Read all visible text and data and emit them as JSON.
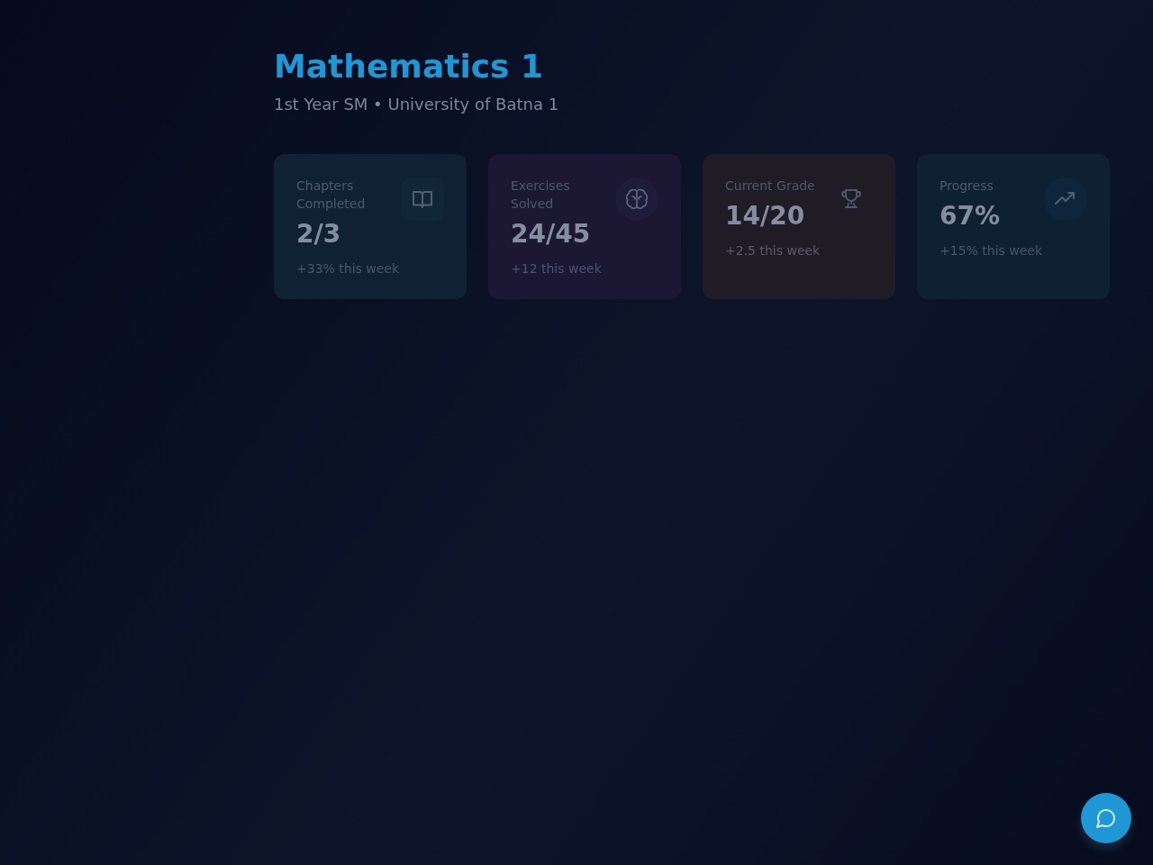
{
  "header": {
    "title": "Mathematics 1",
    "subtitle": "1st Year SM • University of Batna 1"
  },
  "stat_cards": [
    {
      "kind": "book",
      "label": "Chapters Completed",
      "value": "2/3",
      "change": "+33% this week",
      "color": "#0f2234"
    },
    {
      "kind": "brain",
      "label": "Exercises Solved",
      "value": "24/45",
      "change": "+12 this week",
      "color": "#1c1833"
    },
    {
      "kind": "trophy",
      "label": "Current Grade",
      "value": "14/20",
      "change": "+2.5 this week",
      "color": "#201c25"
    },
    {
      "kind": "trend",
      "label": "Progress",
      "value": "67%",
      "change": "+15% this week",
      "color": "#0e2133"
    }
  ]
}
